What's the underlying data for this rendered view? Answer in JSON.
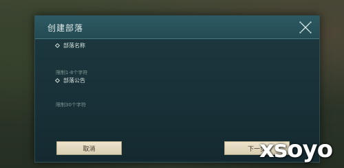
{
  "dialog": {
    "title": "创建部落",
    "close_icon": "close-cross-icon"
  },
  "fields": {
    "name": {
      "label": "部落名称",
      "value": "",
      "placeholder": "限制1-8个字符"
    },
    "notice": {
      "label": "部落公告",
      "value": "",
      "placeholder": "限制30个字符"
    }
  },
  "buttons": {
    "cancel": "取消",
    "next": "下一步"
  },
  "watermark": "xsoyo",
  "colors": {
    "dialog_bg": "#183037",
    "header_bg": "#2d5a63",
    "button_bg": "#e6dcc2",
    "text_light": "#e4ecea",
    "placeholder": "#7e9895"
  }
}
